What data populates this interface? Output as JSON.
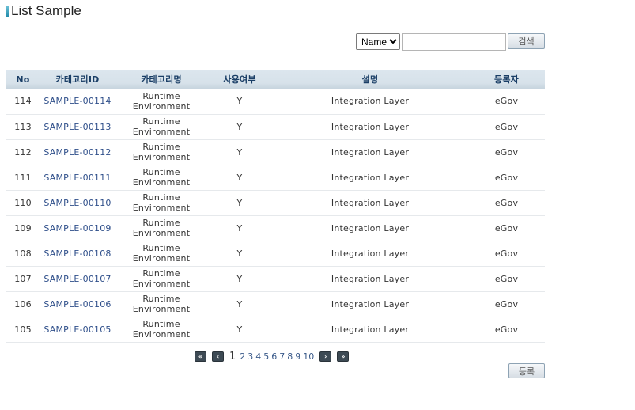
{
  "page": {
    "title": "List Sample"
  },
  "search": {
    "select_value": "Name",
    "options": [
      "Name"
    ],
    "input_value": "",
    "button_label": "검색"
  },
  "table": {
    "headers": [
      "No",
      "카테고리ID",
      "카테고리명",
      "사용여부",
      "설명",
      "등록자"
    ],
    "rows": [
      [
        "114",
        "SAMPLE-00114",
        "Runtime Environment",
        "Y",
        "Integration Layer",
        "eGov"
      ],
      [
        "113",
        "SAMPLE-00113",
        "Runtime Environment",
        "Y",
        "Integration Layer",
        "eGov"
      ],
      [
        "112",
        "SAMPLE-00112",
        "Runtime Environment",
        "Y",
        "Integration Layer",
        "eGov"
      ],
      [
        "111",
        "SAMPLE-00111",
        "Runtime Environment",
        "Y",
        "Integration Layer",
        "eGov"
      ],
      [
        "110",
        "SAMPLE-00110",
        "Runtime Environment",
        "Y",
        "Integration Layer",
        "eGov"
      ],
      [
        "109",
        "SAMPLE-00109",
        "Runtime Environment",
        "Y",
        "Integration Layer",
        "eGov"
      ],
      [
        "108",
        "SAMPLE-00108",
        "Runtime Environment",
        "Y",
        "Integration Layer",
        "eGov"
      ],
      [
        "107",
        "SAMPLE-00107",
        "Runtime Environment",
        "Y",
        "Integration Layer",
        "eGov"
      ],
      [
        "106",
        "SAMPLE-00106",
        "Runtime Environment",
        "Y",
        "Integration Layer",
        "eGov"
      ],
      [
        "105",
        "SAMPLE-00105",
        "Runtime Environment",
        "Y",
        "Integration Layer",
        "eGov"
      ]
    ]
  },
  "pagination": {
    "first_icon": "first-page-icon",
    "prev_icon": "prev-page-icon",
    "next_icon": "next-page-icon",
    "last_icon": "last-page-icon",
    "current_page": "1",
    "pages": [
      "1",
      "2",
      "3",
      "4",
      "5",
      "6",
      "7",
      "8",
      "9",
      "10"
    ]
  },
  "actions": {
    "register_label": "등록"
  }
}
